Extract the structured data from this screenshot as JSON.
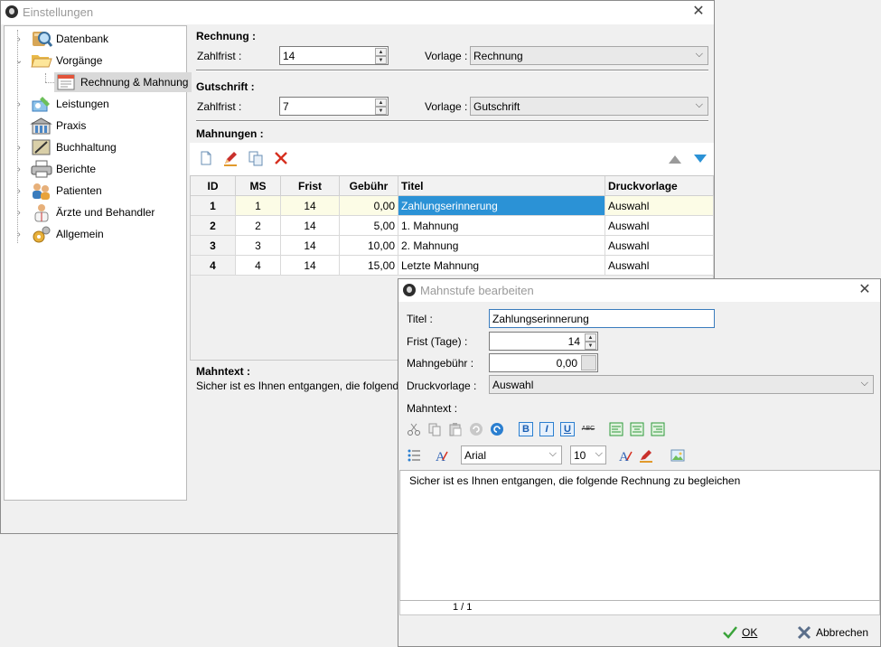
{
  "main_window": {
    "title": "Einstellungen"
  },
  "tree": {
    "items": [
      {
        "label": "Datenbank",
        "icon": "database-search-icon"
      },
      {
        "label": "Vorgänge",
        "icon": "folder-open-icon"
      },
      {
        "label": "Rechnung & Mahnung",
        "icon": "invoice-icon"
      },
      {
        "label": "Leistungen",
        "icon": "services-icon"
      },
      {
        "label": "Praxis",
        "icon": "building-icon"
      },
      {
        "label": "Buchhaltung",
        "icon": "ledger-icon"
      },
      {
        "label": "Berichte",
        "icon": "printer-icon"
      },
      {
        "label": "Patienten",
        "icon": "patients-icon"
      },
      {
        "label": "Ärzte und Behandler",
        "icon": "doctor-icon"
      },
      {
        "label": "Allgemein",
        "icon": "general-settings-icon"
      }
    ]
  },
  "rechnung": {
    "section_title": "Rechnung :",
    "zahlfrist_label": "Zahlfrist :",
    "zahlfrist_value": "14",
    "vorlage_label": "Vorlage :",
    "vorlage_value": "Rechnung"
  },
  "gutschrift": {
    "section_title": "Gutschrift :",
    "zahlfrist_label": "Zahlfrist :",
    "zahlfrist_value": "7",
    "vorlage_label": "Vorlage :",
    "vorlage_value": "Gutschrift"
  },
  "mahnungen": {
    "section_title": "Mahnungen :",
    "columns": [
      "ID",
      "MS",
      "Frist",
      "Gebühr",
      "Titel",
      "Druckvorlage"
    ],
    "rows": [
      {
        "id": "1",
        "ms": "1",
        "frist": "14",
        "gebuehr": "0,00",
        "titel": "Zahlungserinnerung",
        "druckvorlage": "Auswahl"
      },
      {
        "id": "2",
        "ms": "2",
        "frist": "14",
        "gebuehr": "5,00",
        "titel": "1. Mahnung",
        "druckvorlage": "Auswahl"
      },
      {
        "id": "3",
        "ms": "3",
        "frist": "14",
        "gebuehr": "10,00",
        "titel": "2. Mahnung",
        "druckvorlage": "Auswahl"
      },
      {
        "id": "4",
        "ms": "4",
        "frist": "14",
        "gebuehr": "15,00",
        "titel": "Letzte Mahnung",
        "druckvorlage": "Auswahl"
      }
    ],
    "mahntext_label": "Mahntext :",
    "mahntext_preview": "Sicher ist es Ihnen entgangen, die folgende Re"
  },
  "dialog": {
    "title": "Mahnstufe bearbeiten",
    "titel_label": "Titel :",
    "titel_value": "Zahlungserinnerung",
    "frist_label": "Frist (Tage) :",
    "frist_value": "14",
    "gebuehr_label": "Mahngebühr :",
    "gebuehr_value": "0,00",
    "druckvorlage_label": "Druckvorlage :",
    "druckvorlage_value": "Auswahl",
    "mahntext_label": "Mahntext :",
    "font_name": "Arial",
    "font_size": "10",
    "bold_label": "B",
    "italic_label": "I",
    "underline_label": "U",
    "strike_label": "ABC",
    "editor_text": "Sicher ist es Ihnen entgangen, die folgende Rechnung zu begleichen",
    "page_indicator": "1 / 1",
    "ok_label": "OK",
    "cancel_label": "Abbrechen"
  },
  "colors": {
    "selection": "#2b92d6",
    "row_highlight": "#fcfce6"
  }
}
